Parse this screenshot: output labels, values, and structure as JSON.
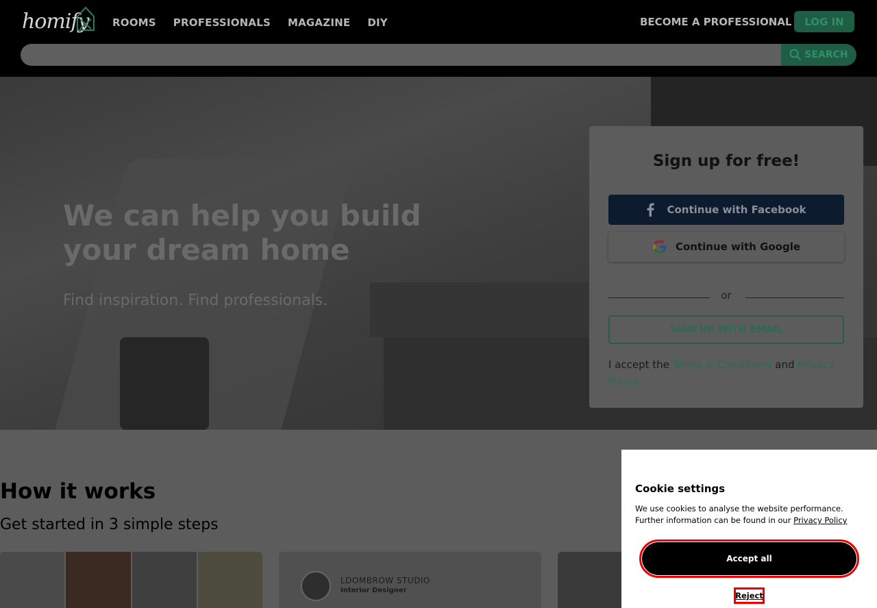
{
  "header": {
    "logo_text": "homify",
    "nav": [
      "ROOMS",
      "PROFESSIONALS",
      "MAGAZINE",
      "DIY"
    ],
    "become_professional": "BECOME A PROFESSIONAL",
    "login": "LOG IN",
    "search_placeholder": "",
    "search_button": "SEARCH"
  },
  "hero": {
    "title": "We can help you build your dream home",
    "subtitle": "Find inspiration. Find professionals."
  },
  "signup": {
    "title": "Sign up for free!",
    "facebook": "Continue with Facebook",
    "google": "Continue with Google",
    "or": "or",
    "email": "SIGN UP WITH EMAIL",
    "accept_prefix": "I accept the ",
    "terms": "Terms & Conditions",
    "and": " and ",
    "privacy": "Privacy Policy"
  },
  "how": {
    "title": "How it works",
    "subtitle": "Get started in 3 simple steps",
    "card2_studio": "LDOMBROW STUDIO",
    "card2_role": "Interior Designer"
  },
  "cookie": {
    "title": "Cookie settings",
    "text": "We use cookies to analyse the website performance. Further information can be found in our ",
    "privacy_link": "Privacy Policy",
    "accept_all": "Accept all",
    "reject": "Reject"
  },
  "colors": {
    "brand_green": "#1f5d45",
    "header_bg": "#000000",
    "highlight_red": "#ee0000"
  }
}
